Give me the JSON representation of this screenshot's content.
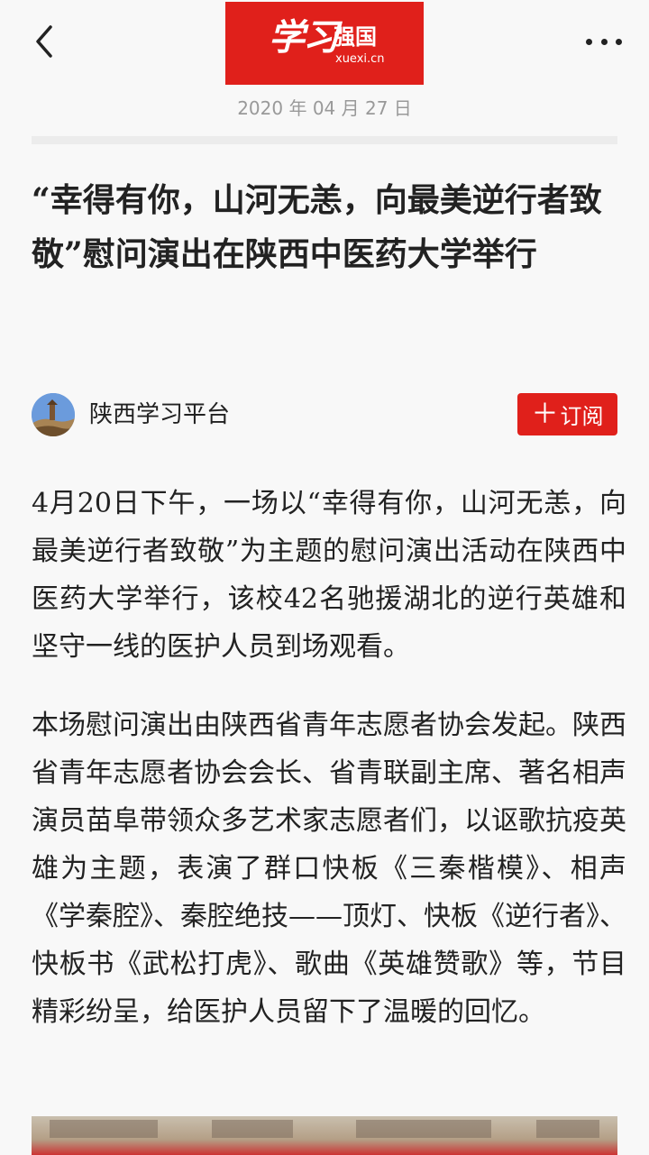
{
  "header": {
    "back_icon": "chevron-left-icon",
    "logo": {
      "calligraphy": "学习",
      "name": "强国",
      "url": "xuexi.cn",
      "color": "#e0201b"
    },
    "more_icon": "more-dots-icon"
  },
  "article": {
    "date": "2020 年 04 月 27 日",
    "title": "“幸得有你，山河无恙，向最美逆行者致敬”慰问演出在陕西中医药大学举行",
    "author": {
      "name": "陕西学习平台",
      "subscribe_label": "订阅"
    },
    "paragraphs": [
      "4月20日下午，一场以“幸得有你，山河无恙，向最美逆行者致敬”为主题的慰问演出活动在陕西中医药大学举行，该校42名驰援湖北的逆行英雄和坚守一线的医护人员到场观看。",
      "本场慰问演出由陕西省青年志愿者协会发起。陕西省青年志愿者协会会长、省青联副主席、著名相声演员苗阜带领众多艺术家志愿者们，以讴歌抗疫英雄为主题，表演了群口快板《三秦楷模》、相声《学秦腔》、秦腔绝技——顶灯、快板《逆行者》、快板书《武松打虎》、歌曲《英雄赞歌》等，节目精彩纷呈，给医护人员留下了温暖的回忆。"
    ]
  },
  "colors": {
    "accent": "#e0201b",
    "text": "#222222",
    "muted": "#999999",
    "background": "#f8f8f8"
  }
}
